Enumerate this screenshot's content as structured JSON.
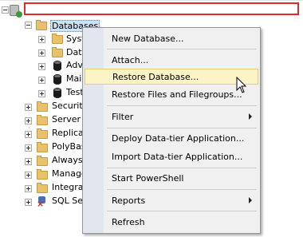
{
  "tree": {
    "root_label": "",
    "databases_label": "Databases",
    "db_children": [
      {
        "label": "Syst",
        "icon": "folder-icon"
      },
      {
        "label": "Data",
        "icon": "folder-icon"
      },
      {
        "label": "Adv",
        "icon": "database-icon"
      },
      {
        "label": "Main",
        "icon": "database-icon"
      },
      {
        "label": "Test",
        "icon": "database-icon"
      }
    ],
    "server_children": [
      {
        "label": "Security"
      },
      {
        "label": "Server O"
      },
      {
        "label": "Replicat"
      },
      {
        "label": "PolyBase"
      },
      {
        "label": "AlwaysO"
      },
      {
        "label": "Manage"
      },
      {
        "label": "Integrat"
      },
      {
        "label": "SQL Ser"
      }
    ]
  },
  "context_menu": {
    "items": [
      {
        "label": "New Database..."
      },
      {
        "label": "Attach..."
      },
      {
        "label": "Restore Database..."
      },
      {
        "label": "Restore Files and Filegroups..."
      },
      {
        "label": "Filter"
      },
      {
        "label": "Deploy Data-tier Application..."
      },
      {
        "label": "Import Data-tier Application..."
      },
      {
        "label": "Start PowerShell"
      },
      {
        "label": "Reports"
      },
      {
        "label": "Refresh"
      }
    ],
    "hovered_item": "Restore Database..."
  },
  "colors": {
    "highlight_box": "#e32a2a",
    "menu_hover": "#fcf4c6",
    "menu_background": "#f0f0f0"
  }
}
